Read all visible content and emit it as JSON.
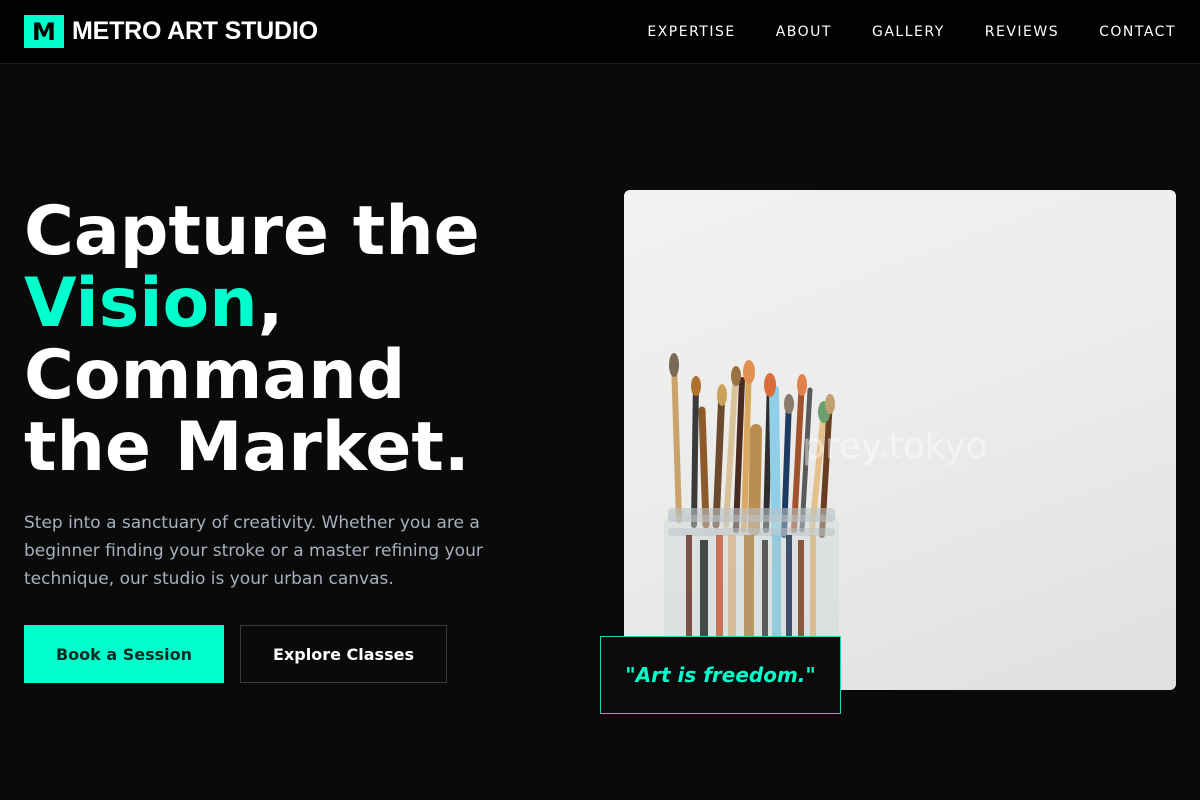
{
  "brand": {
    "mark": "M",
    "name": "METRO ART STUDIO"
  },
  "nav": {
    "items": [
      "EXPERTISE",
      "ABOUT",
      "GALLERY",
      "REVIEWS",
      "CONTACT"
    ]
  },
  "hero": {
    "title_line1": "Capture the",
    "title_accent": "Vision",
    "title_comma": ",",
    "title_line3": "Command",
    "title_line4": "the Market.",
    "description": "Step into a sanctuary of creativity. Whether you are a beginner finding your stroke or a master refining your technique, our studio is your urban canvas.",
    "primary_button": "Book a Session",
    "secondary_button": "Explore Classes",
    "image_icon": "paintbrush-jar-photo",
    "image_watermark": "prey.tokyo",
    "quote": "\"Art is freedom.\""
  },
  "colors": {
    "background": "#0a0a0a",
    "accent": "#00ffcc",
    "text": "#ffffff",
    "muted_text": "#a7b0bb"
  }
}
